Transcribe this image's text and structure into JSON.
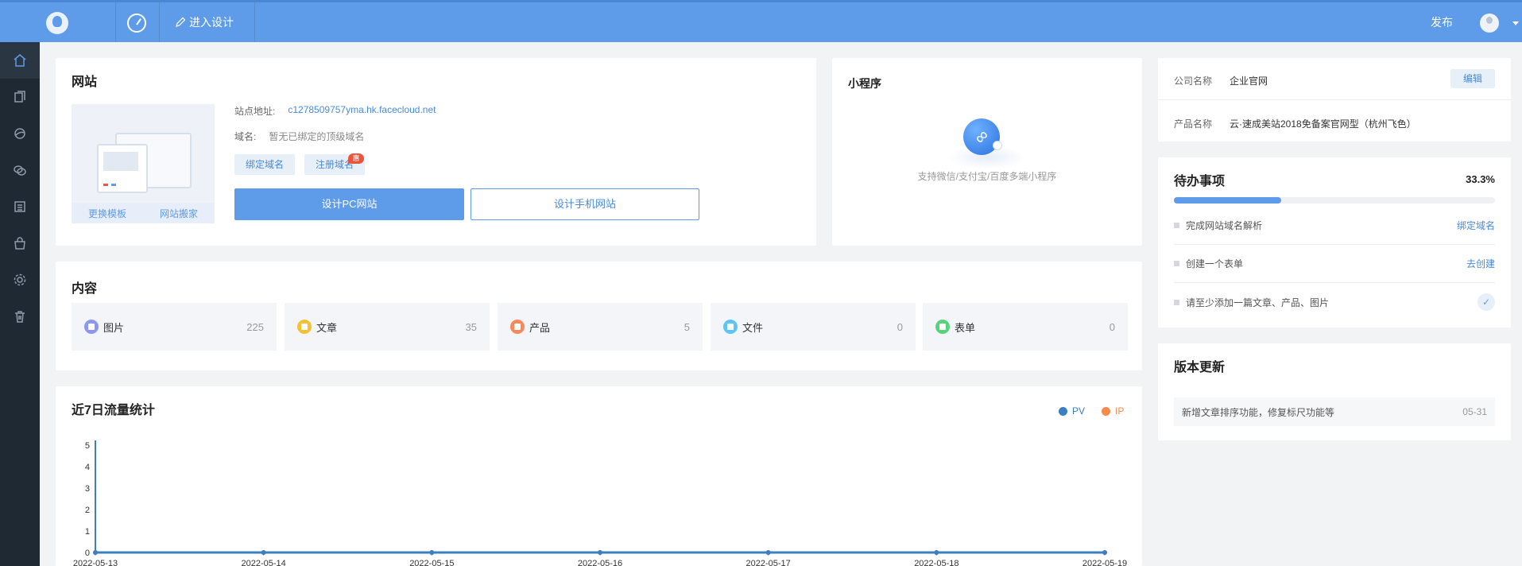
{
  "topbar": {
    "design_label": "进入设计",
    "publish_label": "发布"
  },
  "sidebar": {
    "items": [
      {
        "icon": "home-icon",
        "active": true
      },
      {
        "icon": "pages-icon",
        "active": false
      },
      {
        "icon": "palette-icon",
        "active": false
      },
      {
        "icon": "chat-icon",
        "active": false
      },
      {
        "icon": "list-icon",
        "active": false
      },
      {
        "icon": "shop-bag-icon",
        "active": false
      },
      {
        "icon": "gear-icon",
        "active": false
      },
      {
        "icon": "trash-icon",
        "active": false
      }
    ]
  },
  "website": {
    "title": "网站",
    "change_template": "更换模板",
    "site_move": "网站搬家",
    "site_address_label": "站点地址:",
    "site_address": "c1278509757yma.hk.facecloud.net",
    "domain_label": "域名:",
    "domain_value": "暂无已绑定的顶级域名",
    "bind_domain": "绑定域名",
    "register_domain": "注册域名",
    "hot_badge": "惠",
    "design_pc": "设计PC网站",
    "design_mobile": "设计手机网站"
  },
  "mini_program": {
    "title": "小程序",
    "description": "支持微信/支付宝/百度多端小程序"
  },
  "company": {
    "name_label": "公司名称",
    "name_value": "企业官网",
    "edit_label": "编辑",
    "product_label": "产品名称",
    "product_value": "云·速成美站2018免备案官网型（杭州飞色）"
  },
  "todo": {
    "title": "待办事项",
    "percent_label": "33.3%",
    "progress": 0.333,
    "items": [
      {
        "text": "完成网站域名解析",
        "action": "绑定域名"
      },
      {
        "text": "创建一个表单",
        "action": "去创建"
      },
      {
        "text": "请至少添加一篇文章、产品、图片",
        "action": "✓"
      }
    ]
  },
  "updates": {
    "title": "版本更新",
    "item_text": "新增文章排序功能，修复标尺功能等",
    "item_date": "05-31"
  },
  "content": {
    "title": "内容",
    "stats": [
      {
        "label": "图片",
        "count": "225",
        "color": "#8c97f2"
      },
      {
        "label": "文章",
        "count": "35",
        "color": "#f5c132"
      },
      {
        "label": "产品",
        "count": "5",
        "color": "#f7895a"
      },
      {
        "label": "文件",
        "count": "0",
        "color": "#5bc6f5"
      },
      {
        "label": "表单",
        "count": "0",
        "color": "#58d37c"
      }
    ]
  },
  "traffic": {
    "title": "近7日流量统计",
    "pv_label": "PV",
    "ip_label": "IP",
    "pv_color": "#3c7fc1",
    "ip_color": "#f58a4c"
  },
  "chart_data": {
    "type": "line",
    "title": "近7日流量统计",
    "x": [
      "2022-05-13",
      "2022-05-14",
      "2022-05-15",
      "2022-05-16",
      "2022-05-17",
      "2022-05-18",
      "2022-05-19"
    ],
    "y_ticks": [
      "0",
      "1",
      "2",
      "3",
      "4",
      "5"
    ],
    "ylim": [
      0,
      5
    ],
    "series": [
      {
        "name": "PV",
        "values": [
          0,
          0,
          0,
          0,
          0,
          0,
          0
        ],
        "color": "#3c7fc1"
      },
      {
        "name": "IP",
        "values": [
          0,
          0,
          0,
          0,
          0,
          0,
          0
        ],
        "color": "#f58a4c"
      }
    ],
    "legend": "top-right",
    "grid": false
  }
}
